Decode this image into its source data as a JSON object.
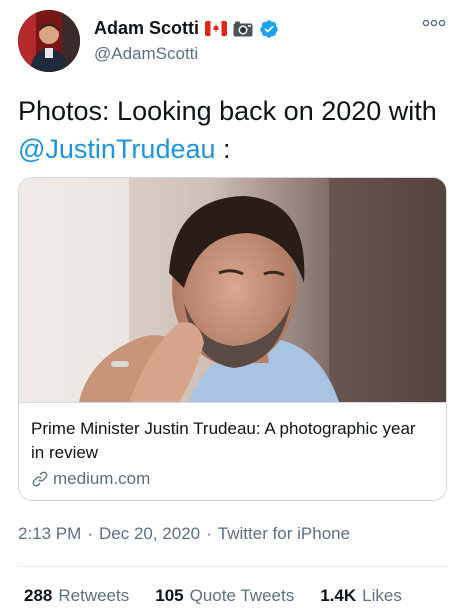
{
  "user": {
    "display_name": "Adam Scotti",
    "handle": "@AdamScotti",
    "badges": [
      "canada-flag-icon",
      "camera-icon",
      "verified-icon"
    ]
  },
  "tweet": {
    "text_prefix": "Photos: Looking back on 2020 with",
    "mention": "@JustinTrudeau",
    "text_suffix": ":"
  },
  "card": {
    "title": "Prime Minister Justin Trudeau: A photographic year in review",
    "domain": "medium.com"
  },
  "meta": {
    "time": "2:13 PM",
    "separator1": "·",
    "date": "Dec 20, 2020",
    "separator2": "·",
    "source": "Twitter for iPhone"
  },
  "stats": [
    {
      "count": "288",
      "label": "Retweets"
    },
    {
      "count": "105",
      "label": "Quote Tweets"
    },
    {
      "count": "1.4K",
      "label": "Likes"
    }
  ],
  "colors": {
    "link": "#1b95e0",
    "secondary_text": "#5b7083",
    "border": "#cfd9de",
    "verified": "#1da1f2"
  }
}
